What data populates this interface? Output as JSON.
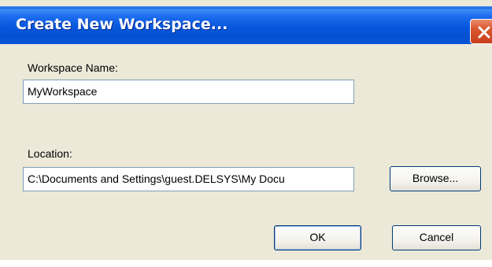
{
  "dialog": {
    "title": "Create New Workspace..."
  },
  "form": {
    "workspace_name_label": "Workspace Name:",
    "workspace_name_value": "MyWorkspace",
    "location_label": "Location:",
    "location_value": "C:\\Documents and Settings\\guest.DELSYS\\My Docu"
  },
  "buttons": {
    "browse_label": "Browse...",
    "ok_label": "OK",
    "cancel_label": "Cancel"
  },
  "icons": {
    "close": "close-icon"
  },
  "colors": {
    "titlebar": "#0757dc",
    "close_button": "#d9562f",
    "dialog_background": "#ece9d8",
    "input_border": "#7f9db9",
    "button_border": "#003c74"
  }
}
